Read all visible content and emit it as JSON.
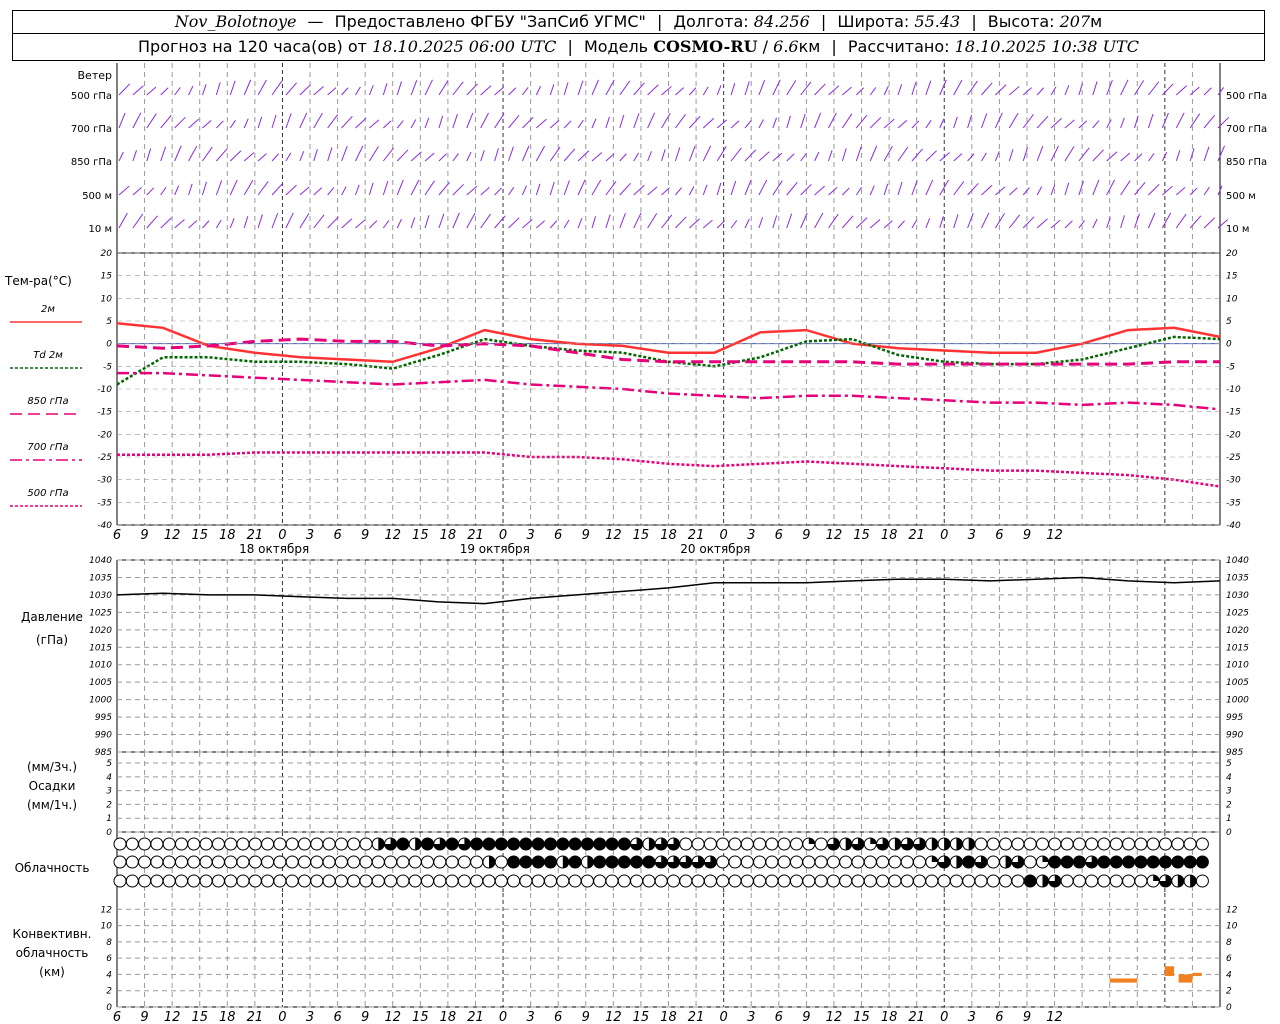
{
  "header": {
    "station": "Nov_Bolotnoye",
    "provider": "Предоставлено ФГБУ \"ЗапСиб УГМС\"",
    "lon_label": "Долгота:",
    "lon_value": "84.256",
    "lat_label": "Широта:",
    "lat_value": "55.43",
    "alt_label": "Высота:",
    "alt_value": "207",
    "alt_unit": "м",
    "forecast_text": "Прогноз на 120 часа(ов) от",
    "forecast_time": "18.10.2025 06:00 UTC",
    "model_label": "Модель",
    "model_name": "COSMO-RU",
    "model_res": "6.6",
    "model_unit": "км",
    "calc_label": "Рассчитано:",
    "calc_time": "18.10.2025 10:38 UTC"
  },
  "colors": {
    "wind": "#8a2be2",
    "t2m": "#ff3333",
    "td2m": "#006600",
    "t850": "#e6007a",
    "t700": "#e6007a",
    "t500": "#e6007a",
    "pressure": "#000000",
    "convective": "#f08020",
    "grid": "#999999"
  },
  "chart_data": [
    {
      "type": "wind_barbs",
      "title": "Ветер",
      "levels": [
        "500 гПа",
        "700 гПа",
        "850 гПа",
        "500 м",
        "10 м"
      ]
    },
    {
      "type": "line",
      "ylabel": "Тем-ра(°C)",
      "ylim": [
        -40,
        20
      ],
      "yticks": [
        20,
        15,
        10,
        5,
        0,
        -5,
        -10,
        -15,
        -20,
        -25,
        -30,
        -35,
        -40
      ],
      "x_hours": [
        0,
        6,
        12,
        18,
        24,
        30,
        36,
        42,
        48,
        54,
        60,
        66,
        72,
        78,
        84,
        90,
        96,
        102,
        108,
        114,
        120
      ],
      "series": [
        {
          "name": "2м",
          "key": "t2m",
          "values": [
            4.5,
            3.5,
            -0.5,
            -2.0,
            -3.0,
            -3.5,
            -4.0,
            -1.0,
            3.0,
            1.0,
            0.0,
            -0.5,
            -2.0,
            -2.0,
            2.5,
            3.0,
            0.0,
            -1.0,
            -1.5,
            -2.0,
            -2.0,
            0.0,
            3.0,
            3.5,
            1.5
          ]
        },
        {
          "name": "Td 2м",
          "key": "td2m",
          "values": [
            -9.0,
            -3.0,
            -3.0,
            -4.0,
            -4.0,
            -4.5,
            -5.5,
            -2.5,
            1.0,
            -0.5,
            -1.5,
            -2.0,
            -4.0,
            -5.0,
            -3.0,
            0.5,
            1.0,
            -2.5,
            -4.0,
            -4.5,
            -4.5,
            -3.5,
            -1.0,
            1.5,
            1.0
          ]
        },
        {
          "name": "850 гПа",
          "key": "t850",
          "values": [
            -0.5,
            -1.0,
            -0.5,
            0.5,
            1.0,
            0.5,
            0.5,
            -0.5,
            0.0,
            -0.5,
            -2.0,
            -3.5,
            -4.0,
            -4.0,
            -4.0,
            -4.0,
            -4.0,
            -4.5,
            -4.5,
            -4.5,
            -4.5,
            -4.5,
            -4.5,
            -4.0,
            -4.0
          ]
        },
        {
          "name": "700 гПа",
          "key": "t700",
          "values": [
            -6.5,
            -6.5,
            -7.0,
            -7.5,
            -8.0,
            -8.5,
            -9.0,
            -8.5,
            -8.0,
            -9.0,
            -9.5,
            -10.0,
            -11.0,
            -11.5,
            -12.0,
            -11.5,
            -11.5,
            -12.0,
            -12.5,
            -13.0,
            -13.0,
            -13.5,
            -13.0,
            -13.5,
            -14.5
          ]
        },
        {
          "name": "500 гПа",
          "key": "t500",
          "values": [
            -24.5,
            -24.5,
            -24.5,
            -24.0,
            -24.0,
            -24.0,
            -24.0,
            -24.0,
            -24.0,
            -25.0,
            -25.0,
            -25.5,
            -26.5,
            -27.0,
            -26.5,
            -26.0,
            -26.5,
            -27.0,
            -27.5,
            -28.0,
            -28.0,
            -28.5,
            -29.0,
            -30.0,
            -31.5
          ]
        }
      ]
    },
    {
      "type": "line",
      "ylabel": "Давление",
      "yunit": "(гПа)",
      "ylim": [
        985,
        1040
      ],
      "yticks": [
        1040,
        1035,
        1030,
        1025,
        1020,
        1015,
        1010,
        1005,
        1000,
        995,
        990,
        985
      ],
      "series": [
        {
          "name": "Давление",
          "key": "pressure",
          "values": [
            1030,
            1030.5,
            1030,
            1030,
            1029.5,
            1029,
            1029,
            1028,
            1027.5,
            1029,
            1030,
            1031,
            1032,
            1033.5,
            1033.5,
            1033.5,
            1034,
            1034.5,
            1034.5,
            1034,
            1034.5,
            1035,
            1034,
            1033.5,
            1034
          ]
        }
      ]
    },
    {
      "type": "bar",
      "ylabel": "Осадки",
      "yunit_top": "(мм/3ч.)",
      "yunit_bottom": "(мм/1ч.)",
      "ylim": [
        0,
        5
      ],
      "yticks": [
        5,
        4,
        3,
        2,
        1,
        0
      ],
      "values": []
    },
    {
      "type": "symbols",
      "ylabel": "Облачность",
      "rows": [
        [
          0,
          0,
          0,
          0,
          0,
          0,
          0,
          0,
          0,
          0,
          0,
          0,
          0,
          0,
          0,
          0,
          0,
          0,
          0,
          0,
          0,
          2,
          3,
          4,
          2,
          4,
          3,
          4,
          3,
          4,
          4,
          4,
          4,
          4,
          4,
          4,
          4,
          4,
          4,
          4,
          4,
          4,
          3,
          2,
          3,
          3,
          0,
          0,
          0,
          0,
          0,
          0,
          0,
          0,
          0,
          0,
          1,
          0,
          3,
          2,
          3,
          1,
          3,
          2,
          3,
          3,
          2,
          2,
          2,
          2,
          0,
          0,
          0,
          0,
          0,
          0,
          0,
          0,
          0,
          0,
          0,
          0,
          0,
          0,
          0,
          0,
          0,
          0,
          0
        ],
        [
          0,
          0,
          0,
          0,
          0,
          0,
          0,
          0,
          0,
          0,
          0,
          0,
          0,
          0,
          0,
          0,
          0,
          0,
          0,
          0,
          0,
          0,
          0,
          0,
          0,
          0,
          0,
          0,
          0,
          0,
          2,
          0,
          4,
          4,
          4,
          4,
          2,
          4,
          2,
          4,
          4,
          4,
          4,
          4,
          3,
          3,
          3,
          3,
          3,
          0,
          0,
          0,
          0,
          0,
          0,
          0,
          0,
          0,
          0,
          0,
          0,
          0,
          0,
          0,
          0,
          0,
          1,
          3,
          2,
          4,
          3,
          0,
          2,
          3,
          0,
          1,
          4,
          4,
          4,
          3,
          4,
          4,
          4,
          4,
          4,
          4,
          4,
          4,
          4
        ],
        [
          0,
          0,
          0,
          0,
          0,
          0,
          0,
          0,
          0,
          0,
          0,
          0,
          0,
          0,
          0,
          0,
          0,
          0,
          0,
          0,
          0,
          0,
          0,
          0,
          0,
          0,
          0,
          0,
          0,
          0,
          0,
          0,
          0,
          0,
          0,
          0,
          0,
          0,
          0,
          0,
          0,
          0,
          0,
          0,
          0,
          0,
          0,
          0,
          0,
          0,
          0,
          0,
          0,
          0,
          0,
          0,
          0,
          0,
          0,
          0,
          0,
          0,
          0,
          0,
          0,
          0,
          0,
          0,
          0,
          0,
          0,
          0,
          0,
          0,
          4,
          2,
          3,
          0,
          0,
          0,
          0,
          0,
          0,
          0,
          1,
          3,
          2,
          2,
          0
        ]
      ]
    },
    {
      "type": "bar",
      "ylabel_lines": [
        "Конвективн.",
        "облачность",
        "(км)"
      ],
      "ylim": [
        0,
        14
      ],
      "yticks": [
        12,
        10,
        8,
        6,
        4,
        2,
        0
      ],
      "segments": [
        {
          "hour_start": 108,
          "hour_end": 111,
          "base_km": 3,
          "top_km": 3.5
        },
        {
          "hour_start": 114,
          "hour_end": 115,
          "base_km": 3.8,
          "top_km": 5.0
        },
        {
          "hour_start": 115.5,
          "hour_end": 117,
          "base_km": 3.0,
          "top_km": 4.0
        },
        {
          "hour_start": 117,
          "hour_end": 118,
          "base_km": 3.8,
          "top_km": 4.2
        }
      ]
    }
  ],
  "x_axis": {
    "tick_labels": [
      "6",
      "9",
      "12",
      "15",
      "18",
      "21",
      "0",
      "3",
      "6",
      "9",
      "12",
      "15",
      "18",
      "21",
      "0",
      "3",
      "6",
      "9",
      "12",
      "15",
      "18",
      "21",
      "0",
      "3",
      "6",
      "9",
      "12",
      "15",
      "18",
      "21",
      "0",
      "3",
      "6",
      "9",
      "12"
    ],
    "date_labels": [
      "18 октября",
      "19 октября",
      "20 октября"
    ]
  }
}
